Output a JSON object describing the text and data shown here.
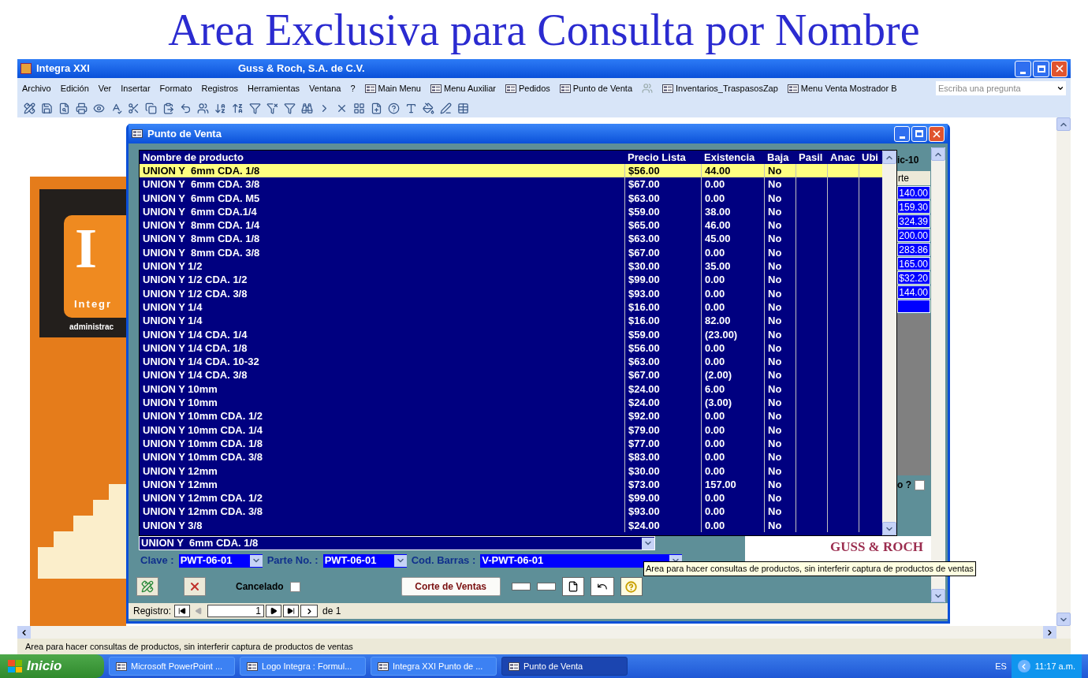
{
  "slide_title": "Area Exclusiva para Consulta por Nombre",
  "app": {
    "title": "Integra XXI",
    "company": "Guss & Roch, S.A. de C.V."
  },
  "menu": [
    "Archivo",
    "Edición",
    "Ver",
    "Insertar",
    "Formato",
    "Registros",
    "Herramientas",
    "Ventana",
    "?"
  ],
  "shortcuts": [
    {
      "label": "Main Menu",
      "kind": "form"
    },
    {
      "label": "Menu Auxiliar",
      "kind": "form"
    },
    {
      "label": "Pedidos",
      "kind": "form"
    },
    {
      "label": "Punto de Venta",
      "kind": "form"
    },
    {
      "kind": "users"
    },
    {
      "label": "Inventarios_TraspasosZap",
      "kind": "form"
    },
    {
      "label": "Menu Venta Mostrador B",
      "kind": "form"
    }
  ],
  "help_box": {
    "placeholder": "Escriba una pregunta"
  },
  "logo": {
    "mark": "I",
    "name": "Integr",
    "subtitle": "administrac"
  },
  "form": {
    "title": "Punto de Venta",
    "columns": [
      "Nombre de producto",
      "Precio Lista",
      "Existencia",
      "Baja",
      "Pasil",
      "Anac",
      "Ubi"
    ],
    "rows": [
      {
        "name": "UNION Y  6mm CDA. 1/8",
        "price": "$56.00",
        "stock": "44.00",
        "baja": "No",
        "selected": true
      },
      {
        "name": "UNION Y  6mm CDA. 3/8",
        "price": "$67.00",
        "stock": "0.00",
        "baja": "No",
        "selected": false
      },
      {
        "name": "UNION Y  6mm CDA. M5",
        "price": "$63.00",
        "stock": "0.00",
        "baja": "No",
        "selected": false
      },
      {
        "name": "UNION Y  6mm CDA.1/4",
        "price": "$59.00",
        "stock": "38.00",
        "baja": "No",
        "selected": false
      },
      {
        "name": "UNION Y  8mm CDA. 1/4",
        "price": "$65.00",
        "stock": "46.00",
        "baja": "No",
        "selected": false
      },
      {
        "name": "UNION Y  8mm CDA. 1/8",
        "price": "$63.00",
        "stock": "45.00",
        "baja": "No",
        "selected": false
      },
      {
        "name": "UNION Y  8mm CDA. 3/8",
        "price": "$67.00",
        "stock": "0.00",
        "baja": "No",
        "selected": false
      },
      {
        "name": "UNION Y 1/2",
        "price": "$30.00",
        "stock": "35.00",
        "baja": "No",
        "selected": false
      },
      {
        "name": "UNION Y 1/2 CDA. 1/2",
        "price": "$99.00",
        "stock": "0.00",
        "baja": "No",
        "selected": false
      },
      {
        "name": "UNION Y 1/2 CDA. 3/8",
        "price": "$93.00",
        "stock": "0.00",
        "baja": "No",
        "selected": false
      },
      {
        "name": "UNION Y 1/4",
        "price": "$16.00",
        "stock": "0.00",
        "baja": "No",
        "selected": false
      },
      {
        "name": "UNION Y 1/4",
        "price": "$16.00",
        "stock": "82.00",
        "baja": "No",
        "selected": false
      },
      {
        "name": "UNION Y 1/4 CDA. 1/4",
        "price": "$59.00",
        "stock": "(23.00)",
        "baja": "No",
        "selected": false
      },
      {
        "name": "UNION Y 1/4 CDA. 1/8",
        "price": "$56.00",
        "stock": "0.00",
        "baja": "No",
        "selected": false
      },
      {
        "name": "UNION Y 1/4 CDA. 10-32",
        "price": "$63.00",
        "stock": "0.00",
        "baja": "No",
        "selected": false
      },
      {
        "name": "UNION Y 1/4 CDA. 3/8",
        "price": "$67.00",
        "stock": "(2.00)",
        "baja": "No",
        "selected": false
      },
      {
        "name": "UNION Y 10mm",
        "price": "$24.00",
        "stock": "6.00",
        "baja": "No",
        "selected": false
      },
      {
        "name": "UNION Y 10mm",
        "price": "$24.00",
        "stock": "(3.00)",
        "baja": "No",
        "selected": false
      },
      {
        "name": "UNION Y 10mm CDA. 1/2",
        "price": "$92.00",
        "stock": "0.00",
        "baja": "No",
        "selected": false
      },
      {
        "name": "UNION Y 10mm CDA. 1/4",
        "price": "$79.00",
        "stock": "0.00",
        "baja": "No",
        "selected": false
      },
      {
        "name": "UNION Y 10mm CDA. 1/8",
        "price": "$77.00",
        "stock": "0.00",
        "baja": "No",
        "selected": false
      },
      {
        "name": "UNION Y 10mm CDA. 3/8",
        "price": "$83.00",
        "stock": "0.00",
        "baja": "No",
        "selected": false
      },
      {
        "name": "UNION Y 12mm",
        "price": "$30.00",
        "stock": "0.00",
        "baja": "No",
        "selected": false
      },
      {
        "name": "UNION Y 12mm",
        "price": "$73.00",
        "stock": "157.00",
        "baja": "No",
        "selected": false
      },
      {
        "name": "UNION Y 12mm CDA. 1/2",
        "price": "$99.00",
        "stock": "0.00",
        "baja": "No",
        "selected": false
      },
      {
        "name": "UNION Y 12mm CDA. 3/8",
        "price": "$93.00",
        "stock": "0.00",
        "baja": "No",
        "selected": false
      },
      {
        "name": "UNION Y 3/8",
        "price": "$24.00",
        "stock": "0.00",
        "baja": "No",
        "selected": false
      }
    ],
    "behind": {
      "heading": "ic-10",
      "column": "rte",
      "amounts": [
        "140.00",
        "159.30",
        "324.39",
        "200.00",
        "283.86",
        "165.00",
        "$32.20",
        "144.00"
      ],
      "question": "o ?",
      "question_checked": false,
      "brand": "GUSS & ROCH"
    },
    "combo": {
      "value": "UNION Y  6mm CDA. 1/8"
    },
    "codes": [
      {
        "label": "Clave :",
        "value": "PWT-06-01"
      },
      {
        "label": "Parte No. :",
        "value": "PWT-06-01"
      },
      {
        "label": "Cod. Barras :",
        "value": "V-PWT-06-01"
      }
    ],
    "tooltip": "Area para hacer consultas de productos, sin interferir captura de productos de ventas",
    "cancelado": {
      "label": "Cancelado",
      "checked": false
    },
    "corte_button": "Corte de Ventas",
    "nav": {
      "label": "Registro:",
      "record": "1",
      "of": "de 1"
    }
  },
  "status_bar": "Area para hacer consultas de productos, sin interferir captura de productos de ventas",
  "taskbar": {
    "start": "Inicio",
    "tasks": [
      {
        "label": "Microsoft PowerPoint ...",
        "selected": false
      },
      {
        "label": "Logo Integra : Formul...",
        "selected": false
      },
      {
        "label": "Integra XXI Punto de ...",
        "selected": false
      },
      {
        "label": "Punto de Venta",
        "selected": true
      }
    ],
    "lang": "ES",
    "time": "11:17 a.m."
  }
}
